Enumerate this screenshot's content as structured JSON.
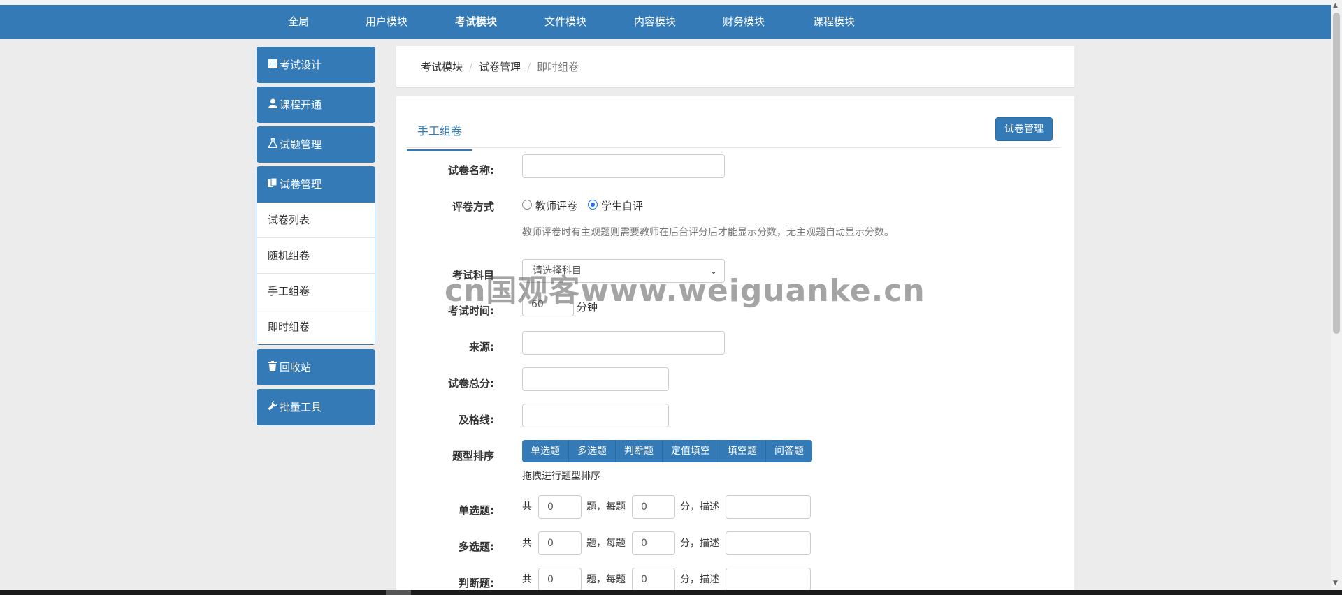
{
  "topnav": {
    "items": [
      "全局",
      "用户模块",
      "考试模块",
      "文件模块",
      "内容模块",
      "财务模块",
      "课程模块"
    ],
    "active": "考试模块"
  },
  "sidebar": {
    "exam_design": {
      "label": "考试设计",
      "icon": "grid-icon"
    },
    "course_open": {
      "label": "课程开通",
      "icon": "user-icon"
    },
    "question_mgmt": {
      "label": "试题管理",
      "icon": "flask-icon"
    },
    "paper_mgmt": {
      "label": "试卷管理",
      "icon": "copy-icon",
      "items": [
        "试卷列表",
        "随机组卷",
        "手工组卷",
        "即时组卷"
      ]
    },
    "recycle": {
      "label": "回收站",
      "icon": "trash-icon"
    },
    "batch_tools": {
      "label": "批量工具",
      "icon": "wrench-icon"
    }
  },
  "breadcrumb": {
    "items": [
      "考试模块",
      "试卷管理"
    ],
    "current": "即时组卷"
  },
  "main": {
    "tab_label": "手工组卷",
    "manage_button": "试卷管理",
    "paper_name_label": "试卷名称:",
    "grading_label": "评卷方式",
    "grading_options": [
      "教师评卷",
      "学生自评"
    ],
    "grading_selected": "学生自评",
    "grading_hint": "教师评卷时有主观题则需要教师在后台评分后才能显示分数，无主观题自动显示分数。",
    "subject_label": "考试科目",
    "subject_placeholder": "请选择科目",
    "time_label": "考试时间:",
    "time_value": "60",
    "time_unit": "分钟",
    "source_label": "来源:",
    "total_label": "试卷总分:",
    "pass_label": "及格线:",
    "order_label": "题型排序",
    "question_types": [
      "单选题",
      "多选题",
      "判断题",
      "定值填空",
      "填空题",
      "问答题"
    ],
    "order_hint": "拖拽进行题型排序",
    "rows": [
      {
        "label": "单选题:",
        "count": "0",
        "score": "0"
      },
      {
        "label": "多选题:",
        "count": "0",
        "score": "0"
      },
      {
        "label": "判断题:",
        "count": "0",
        "score": "0"
      }
    ],
    "row_text": {
      "total": "共",
      "per": "题，每题",
      "score": "分，描述"
    }
  },
  "watermark": "cn国观客www.weiguanke.cn",
  "colors": {
    "primary": "#337ab7",
    "background": "#ececec"
  }
}
